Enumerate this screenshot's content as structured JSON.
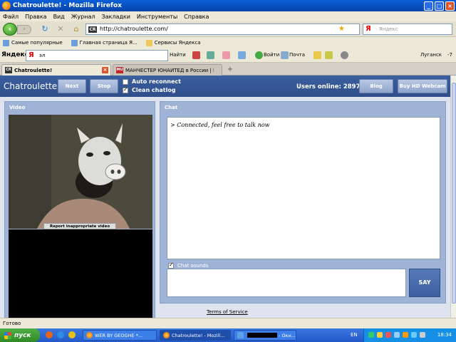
{
  "window": {
    "title": "Chatroulette! - Mozilla Firefox"
  },
  "menu": [
    "Файл",
    "Правка",
    "Вид",
    "Журнал",
    "Закладки",
    "Инструменты",
    "Справка"
  ],
  "nav": {
    "url": "http://chatroulette.com/",
    "search_placeholder": "Яндекс"
  },
  "bookmarks": [
    "Самые популярные",
    "Главная страница Я...",
    "Сервисы Яндекса"
  ],
  "yandex_toolbar": {
    "brand": "Яндекс",
    "query": "эл",
    "find": "Найти",
    "login": "Войти",
    "mail": "Почта",
    "city": "Луганск",
    "temp": "-7"
  },
  "tabs": [
    {
      "label": "Chatroulette!",
      "active": true
    },
    {
      "label": "МАНЧЕСТЕР ЮНАЙТЕД в России | Ма...",
      "active": false
    }
  ],
  "site": {
    "brand": "Chatroulette",
    "next": "Next",
    "stop": "Stop",
    "auto_reconnect": "Auto reconnect",
    "clean_chatlog": "Clean chatlog",
    "auto_reconnect_checked": false,
    "clean_chatlog_checked": true,
    "users_online": "Users online: 2897",
    "blog": "Blog",
    "hd_webcam": "Buy HD Webcam",
    "video_title": "Video",
    "report": "Report inappropriate video",
    "chat_title": "Chat",
    "chat_message": "> Connected, feel free to talk now",
    "chat_sounds": "Chat sounds",
    "chat_sounds_checked": true,
    "say": "SAY",
    "tos": "Terms of Service"
  },
  "status": "Готово",
  "taskbar": {
    "start": "пуск",
    "tasks": [
      "WER BY GEOGHE *...",
      "Chatroulette! - Mozill...",
      "- Окн..."
    ],
    "lang": "EN",
    "clock": "18:34"
  },
  "colors": {
    "header": "#3b5f9f",
    "panel": "#9fb3d6",
    "page": "#dde4ef"
  }
}
